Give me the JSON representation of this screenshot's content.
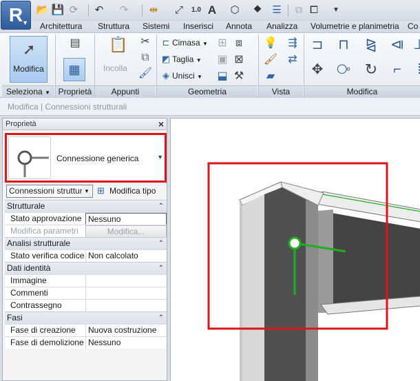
{
  "app": {
    "logo_letter": "R"
  },
  "quick_access": {
    "icons": [
      "open-icon",
      "save-icon",
      "sync-icon",
      "undo-icon",
      "redo-icon",
      "align-icon",
      "dimension-icon",
      "tag-icon",
      "text-icon",
      "3d-view-icon",
      "section-icon",
      "thin-lines-icon",
      "close-windows-icon",
      "switch-windows-icon",
      "customize-icon"
    ],
    "text_tool_label": "A",
    "tag_tool_label": "1.0"
  },
  "ribbon_tabs": [
    "Architettura",
    "Struttura",
    "Sistemi",
    "Inserisci",
    "Annota",
    "Analizza",
    "Volumetrie e planimetria",
    "Co"
  ],
  "ribbon": {
    "seleziona": {
      "button_label": "Modifica",
      "panel_title": "Seleziona"
    },
    "proprieta": {
      "panel_title": "Proprietà"
    },
    "appunti": {
      "paste_label": "Incolla",
      "panel_title": "Appunti"
    },
    "geometria": {
      "cope_label": "Cimasa",
      "cut_label": "Taglia",
      "join_label": "Unisci",
      "panel_title": "Geometria"
    },
    "vista": {
      "panel_title": "Vista"
    },
    "modifica": {
      "panel_title": "Modifica"
    }
  },
  "context_bar": {
    "label": "Modifica | Connessioni strutturali"
  },
  "properties": {
    "title": "Proprietà",
    "type_name": "Connessione generica",
    "instance_filter": "Connessioni struttur",
    "edit_type_label": "Modifica tipo",
    "groups": [
      {
        "name": "Strutturale",
        "rows": [
          {
            "key": "Stato approvazione",
            "value": "Nessuno",
            "style": "edit"
          },
          {
            "key": "Modifica parametri",
            "value": "Modifica...",
            "style": "btn",
            "disabled": true
          }
        ]
      },
      {
        "name": "Analisi strutturale",
        "rows": [
          {
            "key": "Stato verifica codice",
            "value": "Non calcolato",
            "style": ""
          }
        ]
      },
      {
        "name": "Dati identità",
        "rows": [
          {
            "key": "Immagine",
            "value": "",
            "style": ""
          },
          {
            "key": "Commenti",
            "value": "",
            "style": ""
          },
          {
            "key": "Contrassegno",
            "value": "",
            "style": ""
          }
        ]
      },
      {
        "name": "Fasi",
        "rows": [
          {
            "key": "Fase di creazione",
            "value": "Nuova costruzione",
            "style": ""
          },
          {
            "key": "Fase di demolizione",
            "value": "Nessuno",
            "style": ""
          }
        ]
      }
    ]
  },
  "colors": {
    "highlight_red": "#e0131b",
    "connection_green": "#1fae1f",
    "ribbon_blue": "#2e5c9a"
  }
}
